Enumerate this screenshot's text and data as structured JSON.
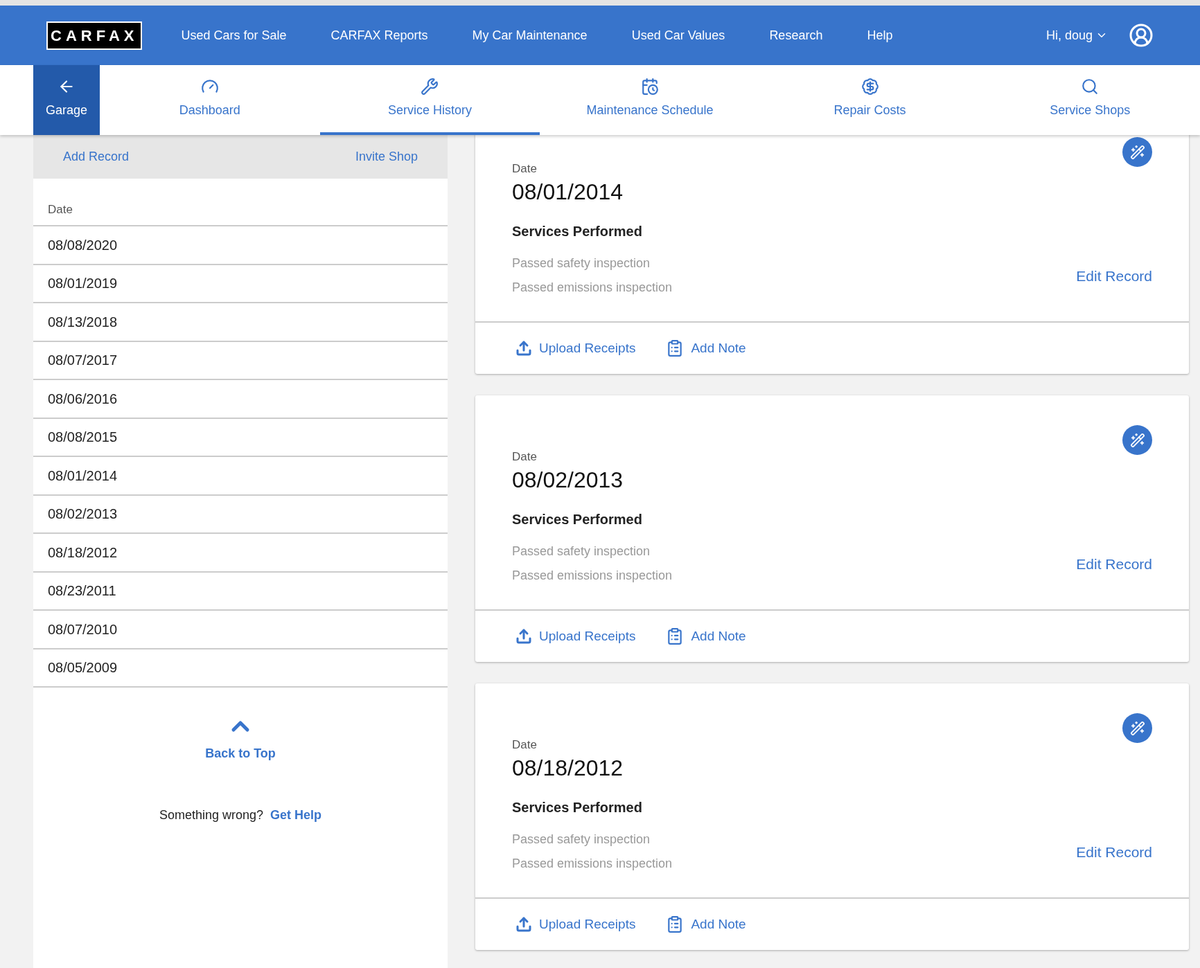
{
  "header": {
    "logo": "CARFAX",
    "nav": [
      "Used Cars for Sale",
      "CARFAX Reports",
      "My Car Maintenance",
      "Used Car Values",
      "Research",
      "Help"
    ],
    "user": "Hi, doug"
  },
  "tabs": [
    {
      "label": "Garage",
      "kind": "back",
      "selected": false
    },
    {
      "label": "Dashboard",
      "kind": "gauge",
      "selected": false
    },
    {
      "label": "Service History",
      "kind": "tools",
      "selected": true
    },
    {
      "label": "Maintenance Schedule",
      "kind": "schedule",
      "selected": false
    },
    {
      "label": "Repair Costs",
      "kind": "dollar",
      "selected": false
    },
    {
      "label": "Service Shops",
      "kind": "search",
      "selected": false
    }
  ],
  "sidebar": {
    "actions": [
      "Add Record",
      "Invite Shop"
    ],
    "column": "Date",
    "dates": [
      "08/08/2020",
      "08/01/2019",
      "08/13/2018",
      "08/07/2017",
      "08/06/2016",
      "08/08/2015",
      "08/01/2014",
      "08/02/2013",
      "08/18/2012",
      "08/23/2011",
      "08/07/2010",
      "08/05/2009"
    ],
    "back_to_top": "Back to Top",
    "help_text": "Something wrong?",
    "help_link": "Get Help"
  },
  "records": [
    {
      "date_label": "Date",
      "date": "08/01/2014",
      "heading": "Services Performed",
      "services": [
        "Passed safety inspection",
        "Passed emissions inspection"
      ],
      "edit": "Edit Record",
      "upload": "Upload Receipts",
      "note": "Add Note"
    },
    {
      "date_label": "Date",
      "date": "08/02/2013",
      "heading": "Services Performed",
      "services": [
        "Passed safety inspection",
        "Passed emissions inspection"
      ],
      "edit": "Edit Record",
      "upload": "Upload Receipts",
      "note": "Add Note"
    },
    {
      "date_label": "Date",
      "date": "08/18/2012",
      "heading": "Services Performed",
      "services": [
        "Passed safety inspection",
        "Passed emissions inspection"
      ],
      "edit": "Edit Record",
      "upload": "Upload Receipts",
      "note": "Add Note"
    }
  ]
}
